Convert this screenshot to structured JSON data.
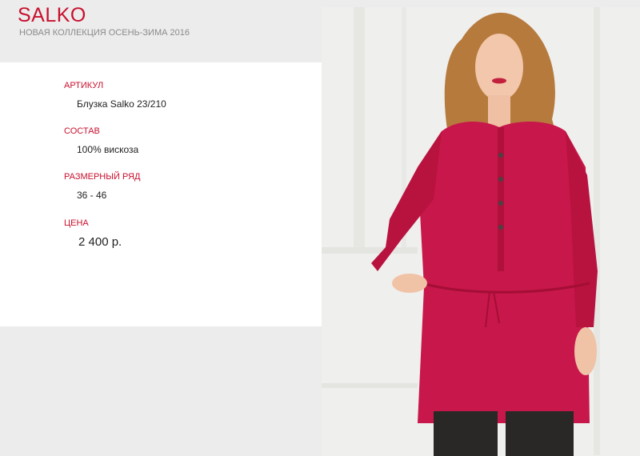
{
  "header": {
    "brand": "SALKO",
    "subtitle": "НОВАЯ КОЛЛЕКЦИЯ ОСЕНЬ-ЗИМА 2016"
  },
  "product": {
    "sku_label": "АРТИКУЛ",
    "sku_value": "Блузка Salko 23/210",
    "composition_label": "СОСТАВ",
    "composition_value": "100% вискоза",
    "sizes_label": "РАЗМЕРНЫЙ РЯД",
    "sizes_value": "36 - 46",
    "price_label": "ЦЕНА",
    "price_value": "2 400 р."
  },
  "colors": {
    "accent": "#c8102e",
    "blouse": "#c8174a",
    "background": "#ececec",
    "panel": "#ffffff"
  }
}
